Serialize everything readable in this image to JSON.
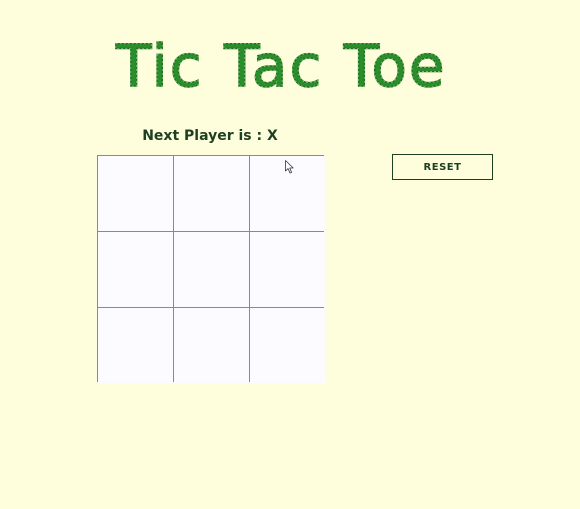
{
  "game": {
    "title": "Tic Tac Toe",
    "status_text": "Next Player is : X",
    "reset_label": "RESET",
    "board": [
      "",
      "",
      "",
      "",
      "",
      "",
      "",
      "",
      ""
    ]
  },
  "colors": {
    "background": "#fffedc",
    "title_green": "#2a8f2a",
    "text_dark_green": "#1e4022",
    "grid_line": "#8a8a8a",
    "cell_fill": "#fcfbff"
  }
}
